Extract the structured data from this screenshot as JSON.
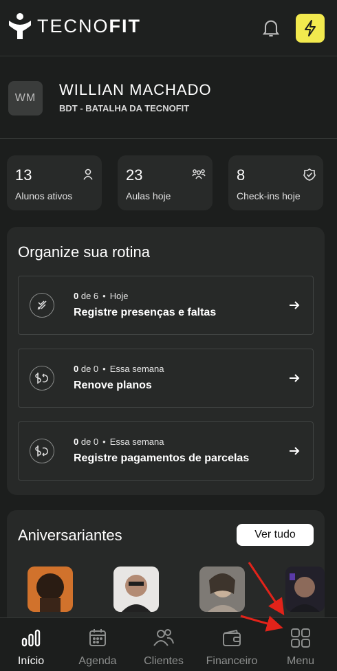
{
  "header": {
    "brand_light": "TECNO",
    "brand_bold": "FIT",
    "icons": [
      "tecnofit-logo-icon",
      "bell-icon",
      "lightning-icon"
    ],
    "accent_color": "#f2e94e"
  },
  "profile": {
    "initials": "WM",
    "name": "WILLIAN MACHADO",
    "subtitle": "BDT - BATALHA DA TECNOFIT"
  },
  "stats": [
    {
      "value": "13",
      "label": "Alunos ativos",
      "icon": "person-icon"
    },
    {
      "value": "23",
      "label": "Aulas hoje",
      "icon": "group-icon"
    },
    {
      "value": "8",
      "label": "Check-ins hoje",
      "icon": "check-badge-icon"
    }
  ],
  "rotina": {
    "title": "Organize sua rotina",
    "tasks": [
      {
        "count": "0",
        "of": "de 6",
        "period": "Hoje",
        "title": "Registre presenças e faltas",
        "icon": "attendance-icon"
      },
      {
        "count": "0",
        "of": "de 0",
        "period": "Essa semana",
        "title": "Renove planos",
        "icon": "renew-money-icon"
      },
      {
        "count": "0",
        "of": "de 0",
        "period": "Essa semana",
        "title": "Registre pagamentos de parcelas",
        "icon": "payment-money-icon"
      }
    ]
  },
  "aniversariantes": {
    "title": "Aniversariantes",
    "see_all": "Ver tudo"
  },
  "bottom_nav": [
    {
      "label": "Início",
      "icon": "chart-bars-icon",
      "active": true
    },
    {
      "label": "Agenda",
      "icon": "calendar-icon",
      "active": false
    },
    {
      "label": "Clientes",
      "icon": "users-icon",
      "active": false
    },
    {
      "label": "Financeiro",
      "icon": "wallet-icon",
      "active": false
    },
    {
      "label": "Menu",
      "icon": "grid-icon",
      "active": false
    }
  ]
}
